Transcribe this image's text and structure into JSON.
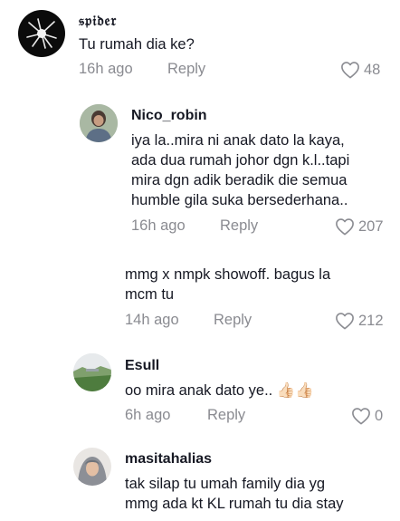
{
  "comments": [
    {
      "username": "𝔰𝔭𝔦𝔡𝔢𝔯",
      "text": "Tu rumah dia ke?",
      "time": "16h ago",
      "reply_label": "Reply",
      "likes": "48",
      "avatar_icon": "spider-avatar"
    },
    {
      "username": "Nico_robin",
      "text": "iya la..mira ni anak dato la kaya,\nada dua rumah johor dgn k.l..tapi\nmira dgn adik beradik die semua\nhumble gila suka bersederhana..",
      "time": "16h ago",
      "reply_label": "Reply",
      "likes": "207",
      "avatar_icon": "user-photo-avatar"
    },
    {
      "username": "",
      "text": "mmg x nmpk showoff. bagus la\nmcm tu",
      "time": "14h ago",
      "reply_label": "Reply",
      "likes": "212"
    },
    {
      "username": "Esull",
      "text": "oo mira anak dato ye.. 👍🏻👍🏻",
      "time": "6h ago",
      "reply_label": "Reply",
      "likes": "0",
      "avatar_icon": "landscape-avatar"
    },
    {
      "username": "masitahalias",
      "text": "tak silap tu umah family dia yg\nmmg ada kt KL rumah tu dia stay",
      "avatar_icon": "hijab-user-avatar"
    }
  ],
  "colors": {
    "text": "#161823",
    "muted": "#8a8b91",
    "background": "#ffffff"
  }
}
